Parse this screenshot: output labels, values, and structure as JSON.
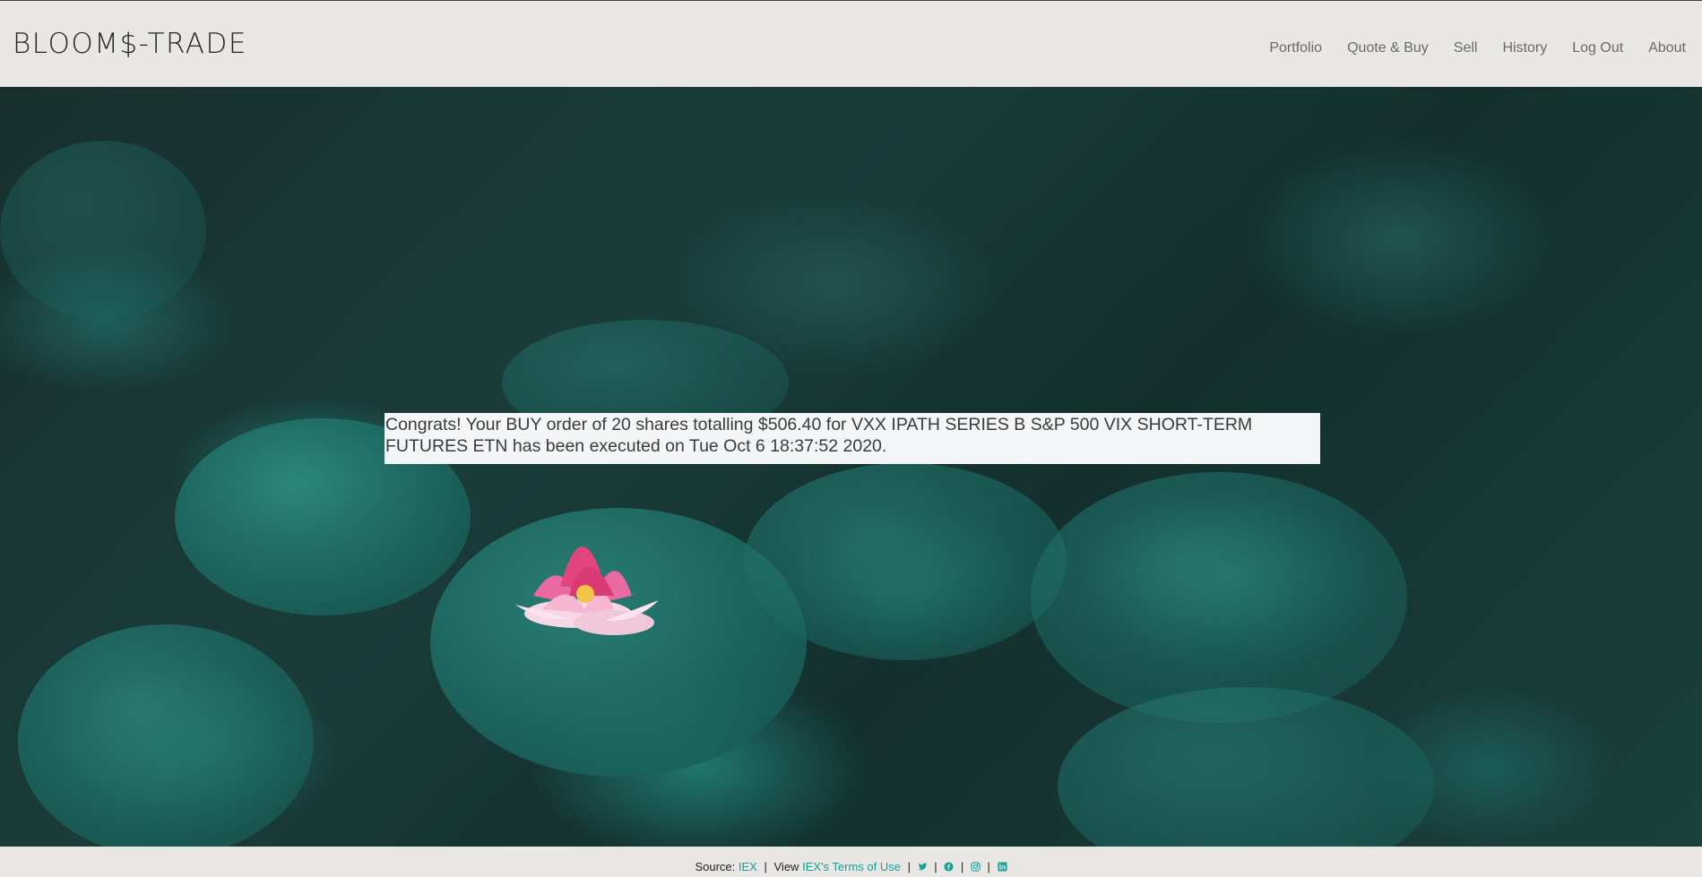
{
  "header": {
    "brand": "BLOOM$-TRADE",
    "nav": [
      {
        "label": "Portfolio"
      },
      {
        "label": "Quote & Buy"
      },
      {
        "label": "Sell"
      },
      {
        "label": "History"
      },
      {
        "label": "Log Out"
      },
      {
        "label": "About"
      }
    ]
  },
  "main": {
    "message": "Congrats! Your BUY order of 20 shares totalling $506.40 for VXX IPATH SERIES B S&P 500 VIX SHORT-TERM FUTURES ETN has been executed on Tue Oct 6 18:37:52 2020."
  },
  "footer": {
    "source_label": "Source:",
    "source_link": "IEX",
    "view_label": "View",
    "terms_link": "IEX's Terms of Use",
    "separator": "|",
    "social_icons": [
      "twitter-icon",
      "facebook-icon",
      "instagram-icon",
      "linkedin-icon"
    ]
  },
  "colors": {
    "accent": "#14a19a",
    "header_bg": "#e8e7e3",
    "pad_green": "#1f776e"
  }
}
